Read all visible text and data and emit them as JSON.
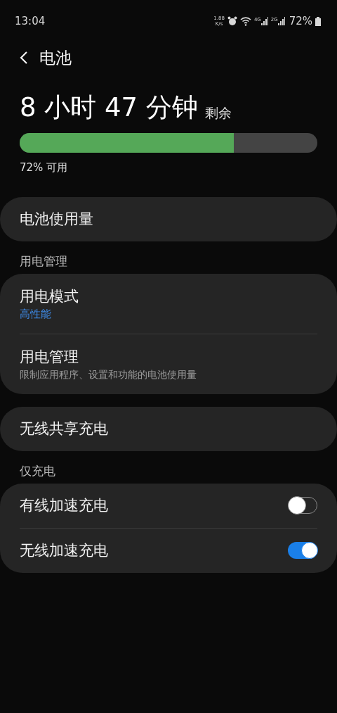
{
  "status_bar": {
    "time": "13:04",
    "net_speed": [
      "1.88",
      "K/s"
    ],
    "networks": [
      "4G",
      "2G"
    ],
    "battery": "72%"
  },
  "header": {
    "title": "电池"
  },
  "summary": {
    "remaining": "8 小时 47 分钟",
    "suffix": "剩余",
    "level": 0.72,
    "available": "72% 可用"
  },
  "groups": [
    {
      "items": [
        {
          "kind": "link",
          "title": "电池使用量"
        }
      ]
    },
    {
      "header": "用电管理",
      "items": [
        {
          "kind": "link",
          "title": "用电模式",
          "subtitle": {
            "kind": "value",
            "text": "高性能"
          }
        },
        {
          "kind": "link",
          "title": "用电管理",
          "subtitle": {
            "kind": "description",
            "text": "限制应用程序、设置和功能的电池使用量"
          }
        }
      ]
    },
    {
      "items": [
        {
          "kind": "link",
          "title": "无线共享充电"
        }
      ]
    },
    {
      "header": "仅充电",
      "items": [
        {
          "kind": "toggle",
          "title": "有线加速充电",
          "on": false
        },
        {
          "kind": "toggle",
          "title": "无线加速充电",
          "on": true
        }
      ]
    }
  ]
}
